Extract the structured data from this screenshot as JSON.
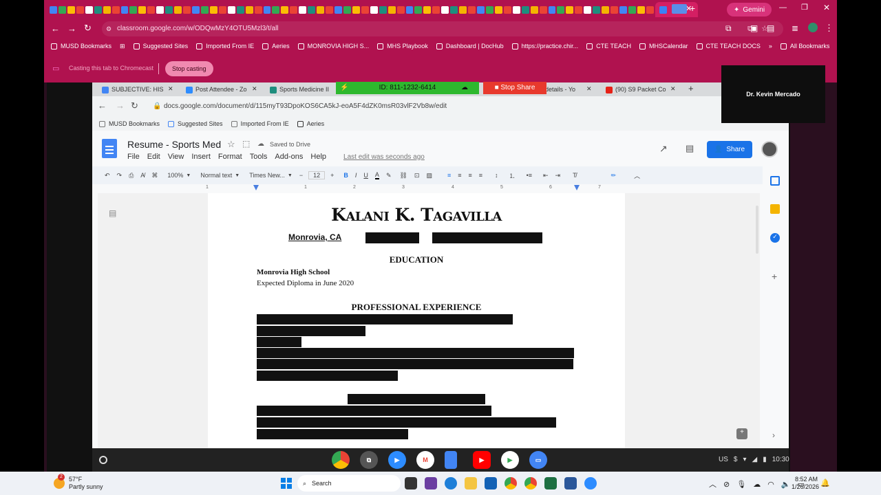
{
  "browser": {
    "url": "classroom.google.com/w/ODQwMzY4OTU5Mzl3/t/all",
    "new_tab": "+",
    "gemini_label": "Gemini",
    "bookmarks": [
      "MUSD Bookmarks",
      "Suggested Sites",
      "Imported From IE",
      "Aeries",
      "MONROVIA HIGH S...",
      "MHS Playbook",
      "Dashboard | DocHub",
      "https://practice.chir...",
      "CTE TEACH",
      "MHSCalendar",
      "CTE TEACH DOCS"
    ],
    "all_bookmarks": "All Bookmarks",
    "cast_text": "Casting this tab to Chromecast",
    "stop_casting": "Stop casting"
  },
  "inner_browser": {
    "tabs": [
      "SUBJECTIVE: HIS",
      "Post Attendee - Zo",
      "Sports Medicine II",
      "details - Yo",
      "(90) S9 Packet Co"
    ],
    "share_id": "ID: 811-1232-6414",
    "stop_share": "Stop Share",
    "url": "docs.google.com/document/d/115myT93DpoKOS6CA5kJ-eoA5F4dZK0msR03vlF2Vb8w/edit",
    "bookmarks": [
      "MUSD Bookmarks",
      "Suggested Sites",
      "Imported From IE",
      "Aeries"
    ]
  },
  "docs": {
    "title": "Resume - Sports Med",
    "saved": "Saved to Drive",
    "menus": [
      "File",
      "Edit",
      "View",
      "Insert",
      "Format",
      "Tools",
      "Add-ons",
      "Help"
    ],
    "last_edit": "Last edit was seconds ago",
    "share": "Share",
    "zoom": "100%",
    "style": "Normal text",
    "font": "Times New...",
    "font_size": "12",
    "ruler_marks": [
      "1",
      "1",
      "2",
      "3",
      "4",
      "5",
      "6",
      "7"
    ]
  },
  "document": {
    "name": "Kalani K. Tagavilla",
    "location": "Monrovia, CA",
    "education_heading": "EDUCATION",
    "school": "Monrovia High School",
    "diploma": "Expected Diploma in June 2020",
    "experience_heading": "PROFESSIONAL EXPERIENCE"
  },
  "camera": {
    "name": "Dr. Kevin Mercado"
  },
  "shelf": {
    "locale": "US",
    "time": "10:30"
  },
  "taskbar": {
    "weather_temp": "57°F",
    "weather_desc": "Partly sunny",
    "weather_badge": "2",
    "search": "Search",
    "time": "8:52 AM",
    "date": "1/26/2026"
  },
  "colors": {
    "chrome_bg": "#b0124f",
    "docs_blue": "#1a73e8",
    "share_green": "#2eb82e",
    "stop_red": "#e8392d"
  }
}
